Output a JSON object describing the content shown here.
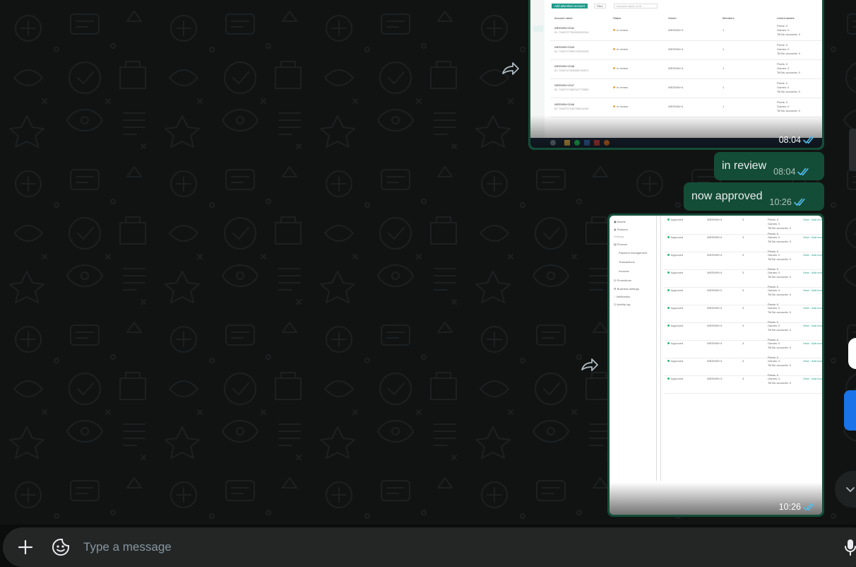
{
  "colors": {
    "outgoing_bubble": "#144d37",
    "background": "#111313",
    "composer": "#242626",
    "read_ticks": "#53bdeb",
    "placeholder": "#8696a0"
  },
  "messages": [
    {
      "type": "image",
      "time": "08:04",
      "status": "read",
      "preview": {
        "toolbar": {
          "add_button": "Add advertiser account",
          "filter_button": "Filter",
          "search_placeholder": "Account name or ID"
        },
        "columns": [
          "Account name",
          "Status",
          "Owner",
          "Members",
          "Linked assets"
        ],
        "rows": [
          {
            "name": "WEEWIN+2042",
            "id": "ID: 7549727790932052244",
            "status": "In review",
            "owner": "WEEWIN+4",
            "members": "1",
            "assets": [
              "Pixels: 0",
              "Games: 0",
              "TikTok accounts: 0"
            ]
          },
          {
            "name": "WEEWIN+2049",
            "id": "ID: 7549727906722943233",
            "status": "In review",
            "owner": "WEEWIN+4",
            "members": "1",
            "assets": [
              "Pixels: 0",
              "Games: 0",
              "TikTok accounts: 0"
            ]
          },
          {
            "name": "WEEWIN+2048",
            "id": "ID: 7549727403806743972",
            "status": "In review",
            "owner": "WEEWIN+4",
            "members": "1",
            "assets": [
              "Pixels: 0",
              "Games: 0",
              "TikTok accounts: 0"
            ]
          },
          {
            "name": "WEEWIN+2047",
            "id": "ID: 7549727482047773953",
            "status": "In review",
            "owner": "WEEWIN+4",
            "members": "1",
            "assets": [
              "Pixels: 0",
              "Games: 0",
              "TikTok accounts: 0"
            ]
          },
          {
            "name": "WEEWIN+2046",
            "id": "ID: 7549727446798444199",
            "status": "In review",
            "owner": "WEEWIN+4",
            "members": "1",
            "assets": [
              "Pixels: 0",
              "Games: 0",
              "TikTok accounts: 0"
            ]
          }
        ]
      }
    },
    {
      "type": "text",
      "text": "in review",
      "time": "08:04",
      "status": "read"
    },
    {
      "type": "text",
      "text": "now approved",
      "time": "10:26",
      "status": "read"
    },
    {
      "type": "image",
      "time": "10:26",
      "status": "read",
      "preview": {
        "sidebar": [
          "Assets",
          "Partners",
          "Settings",
          "Finance",
          "Payment management",
          "Transactions",
          "Invoices",
          "Promotions",
          "Business settings",
          "Verification",
          "Activity log"
        ],
        "row_status": "Approved",
        "row_assets": [
          "Pixels: 0",
          "Games: 0",
          "TikTok accounts: 0"
        ],
        "row_actions": [
          "View",
          "Add more"
        ],
        "rows": [
          {
            "owner": "WEEWIN+4",
            "members": "3"
          },
          {
            "owner": "WEEWIN+4",
            "members": "3"
          },
          {
            "owner": "WEEWIN+4",
            "members": "3"
          },
          {
            "owner": "WEEWIN+4",
            "members": "3"
          },
          {
            "owner": "WEEWIN+2",
            "members": "3"
          },
          {
            "owner": "WEEWIN+4",
            "members": "3"
          },
          {
            "owner": "WEEWIN+4",
            "members": "3"
          },
          {
            "owner": "WEEWIN+4",
            "members": "3"
          },
          {
            "owner": "WEEWIN+4",
            "members": "3"
          },
          {
            "owner": "WEEWIN+3",
            "members": "3"
          }
        ]
      }
    }
  ],
  "composer": {
    "placeholder": "Type a message",
    "attach_icon": "plus-icon",
    "sticker_icon": "sticker-icon",
    "mic_icon": "microphone-icon"
  }
}
